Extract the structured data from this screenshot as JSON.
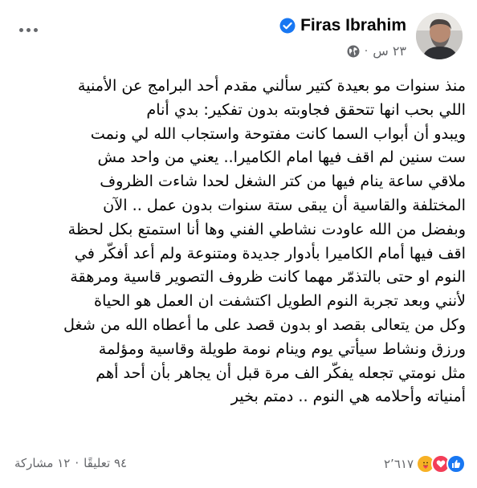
{
  "post": {
    "author": "Firas Ibrahim",
    "time": "٢٣ س",
    "separator": "·",
    "icons": {
      "verified": "verified-badge-icon",
      "privacy": "globe-icon",
      "more": "more-options-icon"
    },
    "lines": [
      "منذ سنوات مو بعيدة كتير سألني مقدم أحد البرامج عن الأمنية",
      "اللي بحب انها تتحقق فجاوبته بدون تفكير: بدي أنام",
      "ويبدو أن أبواب السما كانت مفتوحة واستجاب الله لي ونمت",
      "ست سنين لم اقف فيها امام الكاميرا.. يعني من واحد مش",
      "ملاقي ساعة ينام فيها من كتر الشغل لحدا شاءت الظروف",
      "المختلفة والقاسية أن يبقى ستة سنوات بدون عمل .. الآن",
      "وبفضل من الله عاودت نشاطي الفني وها أنا استمتع بكل لحظة",
      "اقف فيها أمام الكاميرا بأدوار جديدة ومتنوعة ولم أعد أفكّر في",
      "النوم او حتى بالتذمّر مهما كانت ظروف التصوير قاسية ومرهقة",
      "لأنني وبعد تجربة النوم الطويل اكتشفت ان العمل هو الحياة",
      "وكل من يتعالى بقصد او بدون قصد على ما أعطاه الله من شغل",
      "ورزق ونشاط سيأتي يوم وينام نومة طويلة وقاسية ومؤلمة",
      "مثل نومتي تجعله يفكّر الف مرة قبل أن يجاهر بأن أحد أهم",
      "أمنياته وأحلامه هي النوم .. دمتم بخير"
    ]
  },
  "footer": {
    "reaction_count": "٢٬٦١٧",
    "reactions": [
      "like",
      "love",
      "care"
    ],
    "comments": "٩٤ تعليقًا",
    "stat_separator": "·",
    "shares": "١٢ مشاركة"
  },
  "colors": {
    "text": "#050505",
    "secondary": "#65676b",
    "like": "#1877f2",
    "love": "#f33e58",
    "care": "#f7b125",
    "verified": "#1877f2"
  }
}
